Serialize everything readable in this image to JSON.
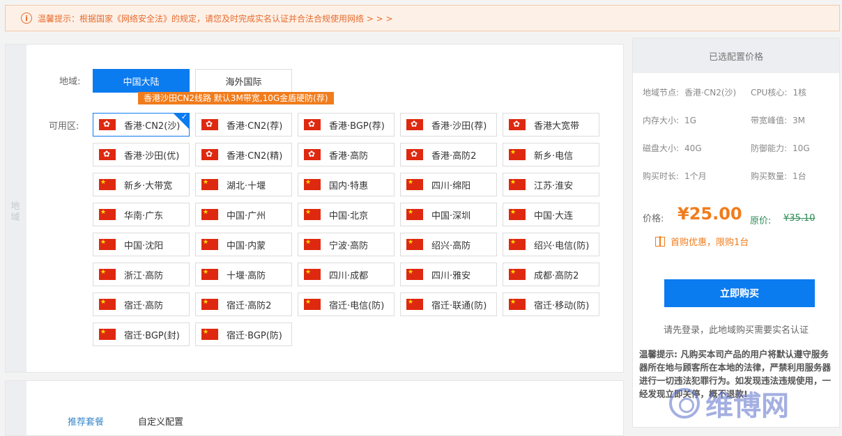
{
  "notice": {
    "icon": "info-circle-icon",
    "text": "温馨提示：根据国家《网络安全法》的规定，请您及时完成实名认证并合法合规使用网络 > > >"
  },
  "left_panel": {
    "side_label": "地域",
    "region_label": "地域:",
    "regions": [
      {
        "label": "中国大陆",
        "active": true
      },
      {
        "label": "海外国际",
        "active": false
      }
    ],
    "promo_tag": "香港沙田CN2线路 默认3M带宽,10G金盾硬防(荐)",
    "zone_label": "可用区:",
    "zones": [
      {
        "label": "香港·CN2(沙)",
        "flag": "hk",
        "selected": true
      },
      {
        "label": "香港·CN2(荐)",
        "flag": "hk"
      },
      {
        "label": "香港·BGP(荐)",
        "flag": "hk"
      },
      {
        "label": "香港·沙田(荐)",
        "flag": "hk"
      },
      {
        "label": "香港大宽带",
        "flag": "hk"
      },
      {
        "label": "香港·沙田(优)",
        "flag": "hk"
      },
      {
        "label": "香港·CN2(精)",
        "flag": "hk"
      },
      {
        "label": "香港·高防",
        "flag": "hk"
      },
      {
        "label": "香港·高防2",
        "flag": "hk"
      },
      {
        "label": "新乡·电信",
        "flag": "cn"
      },
      {
        "label": "新乡·大带宽",
        "flag": "cn"
      },
      {
        "label": "湖北·十堰",
        "flag": "cn"
      },
      {
        "label": "国内·特惠",
        "flag": "cn"
      },
      {
        "label": "四川·绵阳",
        "flag": "cn"
      },
      {
        "label": "江苏·淮安",
        "flag": "cn"
      },
      {
        "label": "华南·广东",
        "flag": "cn"
      },
      {
        "label": "中国·广州",
        "flag": "cn"
      },
      {
        "label": "中国·北京",
        "flag": "cn"
      },
      {
        "label": "中国·深圳",
        "flag": "cn"
      },
      {
        "label": "中国·大连",
        "flag": "cn"
      },
      {
        "label": "中国·沈阳",
        "flag": "cn"
      },
      {
        "label": "中国·内蒙",
        "flag": "cn"
      },
      {
        "label": "宁波·高防",
        "flag": "cn"
      },
      {
        "label": "绍兴·高防",
        "flag": "cn"
      },
      {
        "label": "绍兴·电信(防)",
        "flag": "cn"
      },
      {
        "label": "浙江·高防",
        "flag": "cn"
      },
      {
        "label": "十堰·高防",
        "flag": "cn"
      },
      {
        "label": "四川·成都",
        "flag": "cn"
      },
      {
        "label": "四川·雅安",
        "flag": "cn"
      },
      {
        "label": "成都·高防2",
        "flag": "cn"
      },
      {
        "label": "宿迁·高防",
        "flag": "cn"
      },
      {
        "label": "宿迁·高防2",
        "flag": "cn"
      },
      {
        "label": "宿迁·电信(防)",
        "flag": "cn"
      },
      {
        "label": "宿迁·联通(防)",
        "flag": "cn"
      },
      {
        "label": "宿迁·移动(防)",
        "flag": "cn"
      },
      {
        "label": "宿迁·BGP(封)",
        "flag": "cn"
      },
      {
        "label": "宿迁·BGP(防)",
        "flag": "cn"
      }
    ]
  },
  "bottom_panel": {
    "tabs": [
      {
        "label": "推荐套餐",
        "active": true
      },
      {
        "label": "自定义配置",
        "active": false
      }
    ]
  },
  "right_panel": {
    "title": "已选配置价格",
    "specs": [
      {
        "key": "地域节点:",
        "value": "香港·CN2(沙)"
      },
      {
        "key": "CPU核心:",
        "value": "1核"
      },
      {
        "key": "内存大小:",
        "value": "1G"
      },
      {
        "key": "带宽峰值:",
        "value": "3M"
      },
      {
        "key": "磁盘大小:",
        "value": "40G"
      },
      {
        "key": "防御能力:",
        "value": "10G"
      },
      {
        "key": "购买时长:",
        "value": "1个月"
      },
      {
        "key": "购买数量:",
        "value": "1台"
      }
    ],
    "price_label": "价格:",
    "price": "¥25.00",
    "original_label": "原价:",
    "original_price": "¥35.10",
    "promo": "首购优惠，限购1台",
    "buy_button": "立即购买",
    "login_note": "请先登录，此地域购买需要实名认证",
    "tip": "温馨提示: 凡购买本司产品的用户将默认遵守服务器所在地与顾客所在本地的法律，严禁利用服务器进行一切违法犯罪行为。如发现违法违规使用，一经发现立即关停，概不退款!"
  },
  "watermark": {
    "text": "维博网"
  },
  "colors": {
    "accent": "#0b7bf0",
    "orange": "#f07c1c",
    "green": "#2e8b57"
  }
}
